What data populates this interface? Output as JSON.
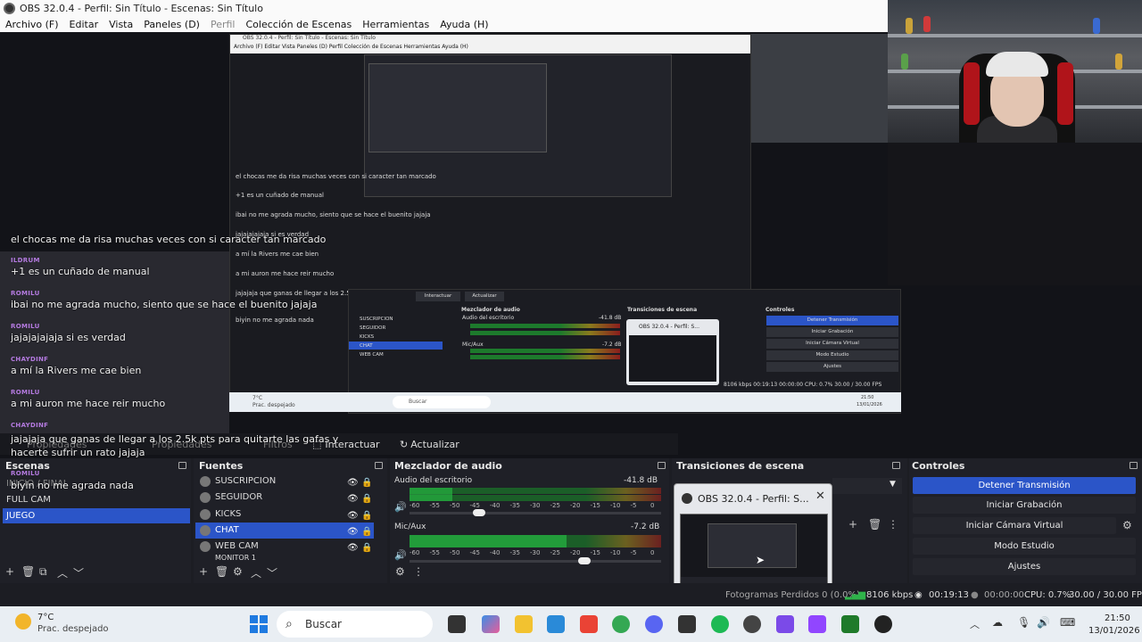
{
  "window": {
    "title": "OBS 32.0.4 - Perfil: Sin Título - Escenas: Sin Título"
  },
  "menu": {
    "items": [
      "Archivo (F)",
      "Editar",
      "Vista",
      "Paneles (D)",
      "Perfil",
      "Colección de Escenas",
      "Herramientas",
      "Ayuda (H)"
    ]
  },
  "chat": {
    "messages": [
      {
        "user": "",
        "text": "el chocas me da risa muchas veces con si caracter tan marcado"
      },
      {
        "user": "ILDRUM",
        "text": "+1 es un cuñado de manual"
      },
      {
        "user": "ROMILU",
        "text": "ibai no me agrada mucho, siento que se hace el buenito jajaja"
      },
      {
        "user": "ROMILU",
        "text": "jajajajajaja si es verdad"
      },
      {
        "user": "CHAYDINF",
        "text": "a mí la Rivers me cae bien"
      },
      {
        "user": "ROMILU",
        "text": "a mi auron me hace reir mucho"
      },
      {
        "user": "CHAYDINF",
        "text": "jajajaja que ganas de llegar a los 2.5k pts para quitarte las gafas y"
      },
      {
        "user": "",
        "text": "hacerte sufrir un rato jajaja"
      },
      {
        "user": "ROMILU",
        "text": "biyin no me agrada nada"
      }
    ]
  },
  "toolbar": {
    "properties": "Propiedades",
    "filters": "Filtros",
    "interact": "Interactuar",
    "refresh": "Actualizar"
  },
  "scenes": {
    "title": "Escenas",
    "items": [
      {
        "label": "INICIO / FINAL"
      },
      {
        "label": "FULL CAM"
      },
      {
        "label": "JUEGO"
      }
    ]
  },
  "sources": {
    "title": "Fuentes",
    "items": [
      {
        "label": "SUSCRIPCION"
      },
      {
        "label": "SEGUIDOR"
      },
      {
        "label": "KICKS"
      },
      {
        "label": "CHAT"
      },
      {
        "label": "WEB CAM"
      },
      {
        "label": "MONITOR 1"
      }
    ]
  },
  "mixer": {
    "title": "Mezclador de audio",
    "channels": [
      {
        "name": "Audio del escritorio",
        "db": "-41.8 dB",
        "level": 0.2
      },
      {
        "name": "Mic/Aux",
        "db": "-7.2 dB",
        "level": 0.8
      }
    ],
    "scale": [
      "-60",
      "-55",
      "-50",
      "-45",
      "-40",
      "-35",
      "-30",
      "-25",
      "-20",
      "-15",
      "-10",
      "-5",
      "0"
    ]
  },
  "transitions": {
    "title": "Transiciones de escena"
  },
  "popup": {
    "title": "OBS 32.0.4 - Perfil: S..."
  },
  "controls": {
    "title": "Controles",
    "buttons": [
      "Detener Transmisión",
      "Iniciar Grabación",
      "Iniciar Cámara Virtual",
      "Modo Estudio",
      "Ajustes"
    ]
  },
  "status": {
    "frames": "Fotogramas Perdidos 0 (0.0%)",
    "bitrate": "8106 kbps",
    "stream_time": "00:19:13",
    "rec_time": "00:00:00",
    "cpu": "CPU: 0.7%",
    "fps": "30.00 / 30.00 FPS"
  },
  "taskbar": {
    "weather_temp": "7°C",
    "weather_desc": "Prac. despejado",
    "search": "Buscar",
    "time": "21:50",
    "date": "13/01/2026"
  },
  "nested": {
    "title": "OBS 32.0.4 - Perfil: Sin Título - Escenas: Sin Título",
    "menu": "Archivo (F)   Editar   Vista   Paneles (D)   Perfil   Colección de Escenas   Herramientas   Ayuda (H)",
    "chat_lines": [
      "el chocas me da risa muchas veces con si caracter tan marcado",
      "+1 es un cuñado de manual",
      "ibai no me agrada mucho, siento que se hace el buenito jajaja",
      "jajajajajaja si es verdad",
      "a mí la Rivers me cae bien",
      "a mi auron me hace reir mucho",
      "jajajaja que ganas de llegar a los 2.5k pts para quitarte las gafas y",
      "biyin no me agrada nada"
    ],
    "panels": {
      "mixer": "Mezclador de audio",
      "transitions": "Transiciones de escena",
      "controls": "Controles",
      "refresh": "Actualizar",
      "interact": "Interactuar",
      "desktop_audio": "Audio del escritorio",
      "mic": "Mic/Aux",
      "db1": "-41.8 dB",
      "db2": "-7.2 dB",
      "popup": "OBS 32.0.4 - Perfil: S...",
      "buttons": [
        "Detener Transmisión",
        "Iniciar Grabación",
        "Iniciar Cámara Virtual",
        "Modo Estudio",
        "Ajustes"
      ],
      "sources": [
        "SUSCRIPCION",
        "SEGUIDOR",
        "KICKS",
        "CHAT",
        "WEB CAM"
      ],
      "scenes": [
        "FULL CAM",
        "JUEGO"
      ],
      "status": "8106 kbps   00:19:13   00:00:00   CPU: 0.7%   30.00 / 30.00 FPS",
      "search": "Buscar",
      "weather": "7°C",
      "weather_desc": "Prac. despejado",
      "time": "21:50",
      "date": "13/01/2026"
    }
  },
  "colors": {
    "accent": "#2b55c8",
    "username": "#b47ae0"
  }
}
